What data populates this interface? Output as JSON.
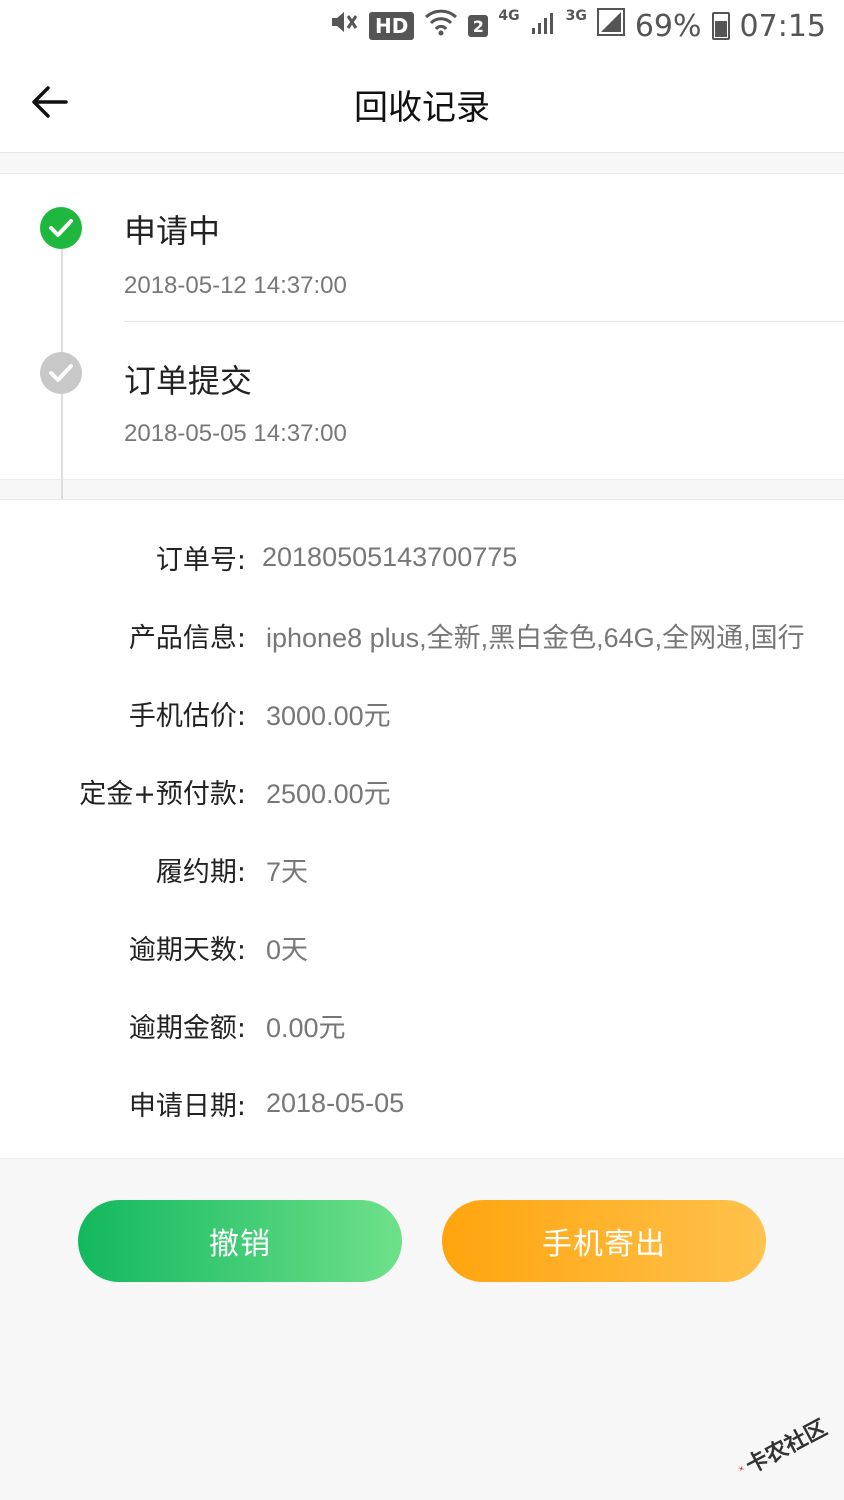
{
  "status_bar": {
    "hd": "HD",
    "sim": "2",
    "net1": "4G",
    "net2": "3G",
    "battery": "69%",
    "time": "07:15"
  },
  "nav": {
    "title": "回收记录"
  },
  "timeline": [
    {
      "title": "申请中",
      "time": "2018-05-12 14:37:00",
      "state": "active",
      "color": "#1db83d"
    },
    {
      "title": "订单提交",
      "time": "2018-05-05 14:37:00",
      "state": "done",
      "color": "#c8c8c8"
    }
  ],
  "details": [
    {
      "label": "订单号:",
      "value": "20180505143700775"
    },
    {
      "label": "产品信息:",
      "value": "iphone8 plus,全新,黑白金色,64G,全网通,国行"
    },
    {
      "label": "手机估价:",
      "value": "3000.00元"
    },
    {
      "label": "定金+预付款:",
      "value": "2500.00元"
    },
    {
      "label": "履约期:",
      "value": "7天"
    },
    {
      "label": "逾期天数:",
      "value": "0天"
    },
    {
      "label": "逾期金额:",
      "value": "0.00元"
    },
    {
      "label": "申请日期:",
      "value": "2018-05-05"
    }
  ],
  "actions": {
    "cancel_label": "撤销",
    "ship_label": "手机寄出"
  },
  "watermark": {
    "text": "卡农社区"
  },
  "colors": {
    "accent_green": "#1db83d",
    "button_green_start": "#12b85f",
    "button_green_end": "#6fe08a",
    "button_orange_start": "#ffa40d",
    "button_orange_end": "#ffc24d"
  }
}
